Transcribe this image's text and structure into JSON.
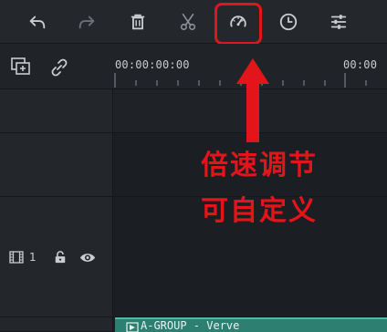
{
  "toolbar": {
    "buttons": [
      {
        "name": "undo",
        "icon": "undo-icon"
      },
      {
        "name": "redo",
        "icon": "redo-icon"
      },
      {
        "name": "delete",
        "icon": "trash-icon"
      },
      {
        "name": "cut",
        "icon": "scissors-icon"
      },
      {
        "name": "speed",
        "icon": "speedometer-icon"
      },
      {
        "name": "duration",
        "icon": "clock-icon"
      },
      {
        "name": "adjust",
        "icon": "sliders-icon"
      }
    ]
  },
  "track_tools": {
    "add_track_icon": "add-track-icon",
    "link_icon": "link-icon"
  },
  "ruler": {
    "start_time": "00:00:00:00",
    "next_time": "00:00"
  },
  "track": {
    "number": "1",
    "icons": [
      "film-icon",
      "unlock-icon",
      "eye-icon"
    ]
  },
  "clip": {
    "label": "A-GROUP - Verve"
  },
  "annotation": {
    "line1": "倍速调节",
    "line2": "可自定义"
  },
  "colors": {
    "annotation": "#e3151a",
    "clip": "#2c7f71",
    "background": "#1b1e22"
  }
}
